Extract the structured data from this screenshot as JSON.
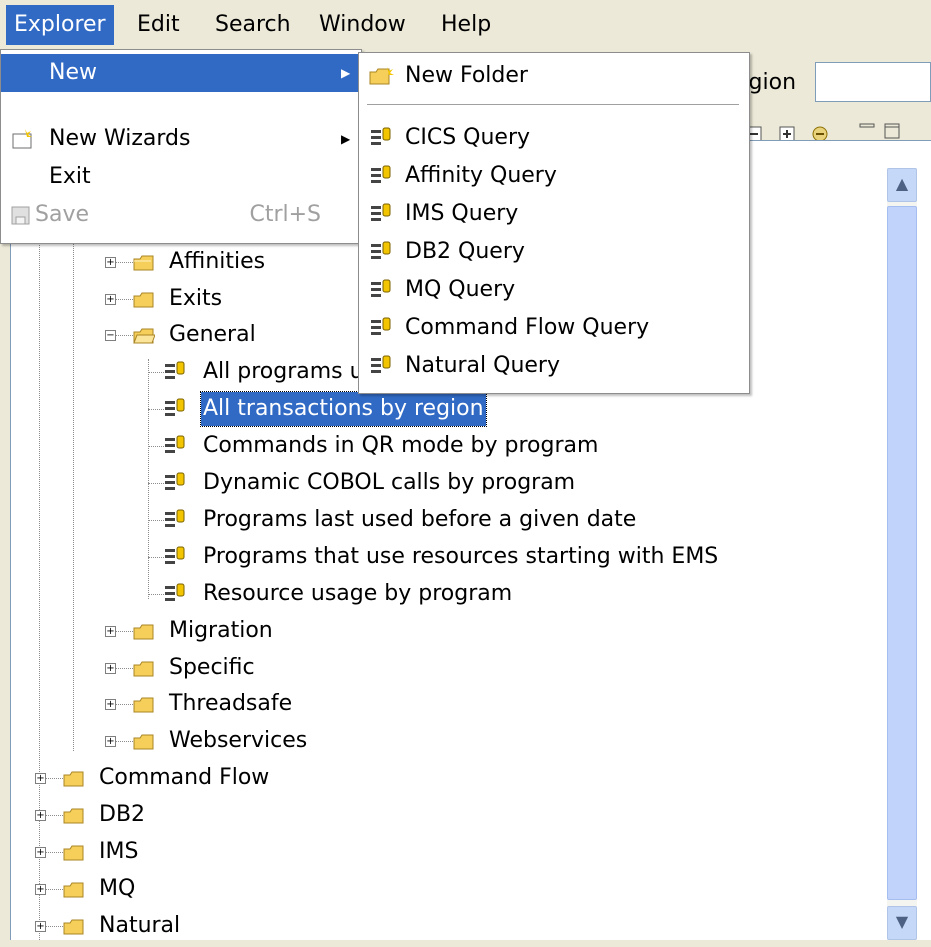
{
  "menubar": {
    "items": [
      {
        "label": "Explorer",
        "active": true
      },
      {
        "label": "Edit"
      },
      {
        "label": "Search"
      },
      {
        "label": "Window"
      },
      {
        "label": "Help"
      }
    ]
  },
  "explorer_menu": {
    "new_label": "New",
    "new_wizards_label": "New Wizards",
    "exit_label": "Exit",
    "save_label": "Save",
    "save_shortcut": "Ctrl+S"
  },
  "new_menu": {
    "folder_label": "New Folder",
    "queries": [
      "CICS Query",
      "Affinity Query",
      "IMS Query",
      "DB2 Query",
      "MQ Query",
      "Command Flow Query",
      "Natural Query"
    ]
  },
  "toolbar": {
    "region_label": "egion",
    "region_value": ""
  },
  "tree": {
    "folders_level2_top": [
      "Affinities",
      "Exits",
      "General"
    ],
    "general_children": [
      "All programs u",
      "All transactions by region",
      "Commands in QR mode by program",
      "Dynamic COBOL calls by program",
      "Programs last used before a given date",
      "Programs that use resources starting with EMS",
      "Resource usage by program"
    ],
    "selected_index": 1,
    "folders_level2_bottom": [
      "Migration",
      "Specific",
      "Threadsafe",
      "Webservices"
    ],
    "folders_level1": [
      "Command Flow",
      "DB2",
      "IMS",
      "MQ",
      "Natural"
    ]
  },
  "colors": {
    "selection": "#316ac5",
    "folder": "#f5cf5a",
    "background": "#ece9d8"
  }
}
